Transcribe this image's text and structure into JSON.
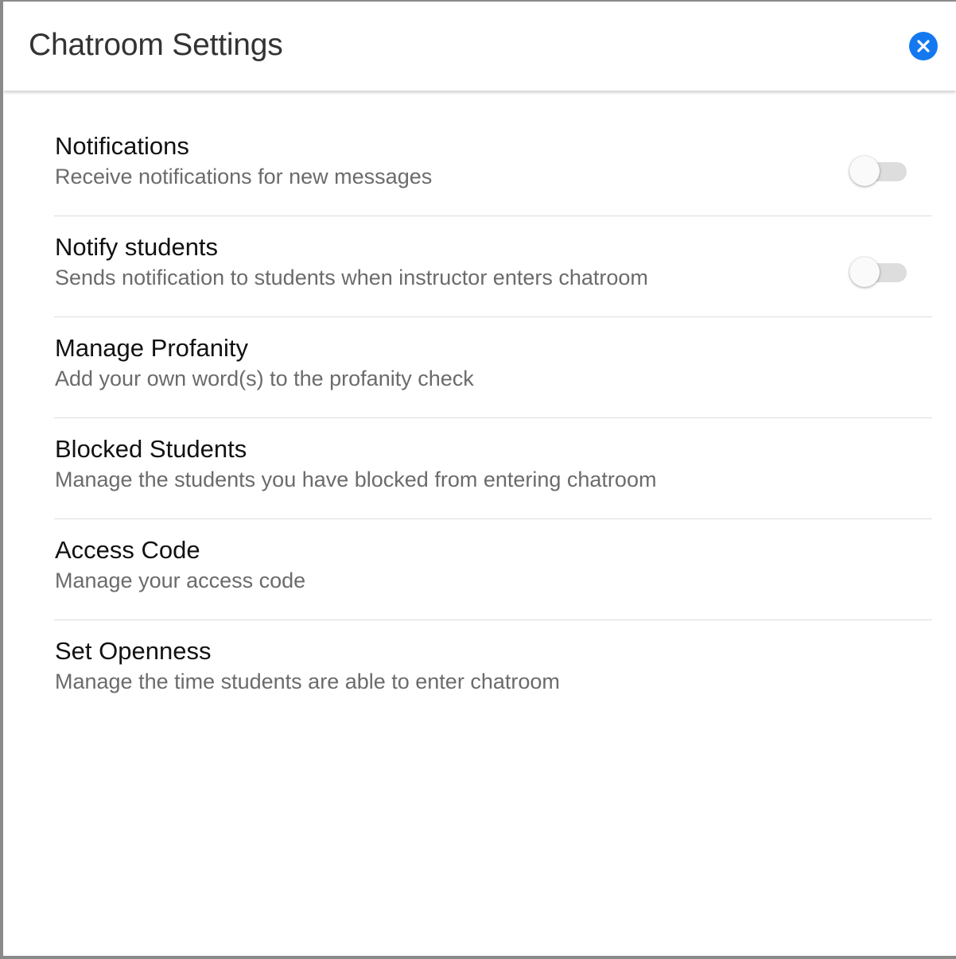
{
  "header": {
    "title": "Chatroom Settings",
    "close_icon": "close-icon",
    "accent_color": "#1479f0"
  },
  "settings": [
    {
      "title": "Notifications",
      "description": "Receive notifications for new messages",
      "has_toggle": true,
      "toggle_on": false
    },
    {
      "title": "Notify students",
      "description": "Sends notification to students when instructor enters chatroom",
      "has_toggle": true,
      "toggle_on": false
    },
    {
      "title": "Manage Profanity",
      "description": "Add your own word(s) to the profanity check",
      "has_toggle": false
    },
    {
      "title": "Blocked Students",
      "description": "Manage the students you have blocked from entering chatroom",
      "has_toggle": false
    },
    {
      "title": "Access Code",
      "description": "Manage your access code",
      "has_toggle": false
    },
    {
      "title": "Set Openness",
      "description": "Manage the time students are able to enter chatroom",
      "has_toggle": false
    }
  ]
}
